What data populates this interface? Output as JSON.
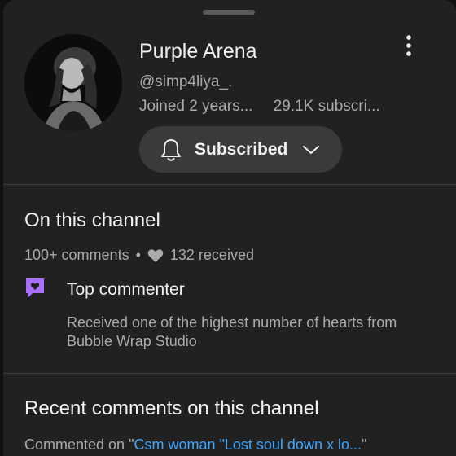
{
  "channel": {
    "name": "Purple Arena",
    "handle": "@simp4liya_.",
    "joined": "Joined 2 years...",
    "subscribers": "29.1K subscri..."
  },
  "subscribe_button": {
    "label": "Subscribed"
  },
  "on_channel": {
    "title": "On this channel",
    "comments": "100+ comments",
    "separator": "•",
    "hearts_received": "132 received",
    "badge": {
      "title": "Top commenter",
      "description": "Received one of the highest number of hearts from Bubble Wrap Studio",
      "color": "#a970ff"
    }
  },
  "recent": {
    "title": "Recent comments on this channel",
    "prefix": "Commented on \"",
    "video_link": "Csm woman \"Lost soul down x lo...",
    "suffix": "\""
  },
  "icons": [
    "more-vert-icon",
    "bell-icon",
    "chevron-down-icon",
    "heart-icon",
    "top-commenter-badge-icon"
  ],
  "colors": {
    "background": "#212121",
    "link": "#3ea6ff",
    "secondary_text": "#aaaaaa"
  }
}
